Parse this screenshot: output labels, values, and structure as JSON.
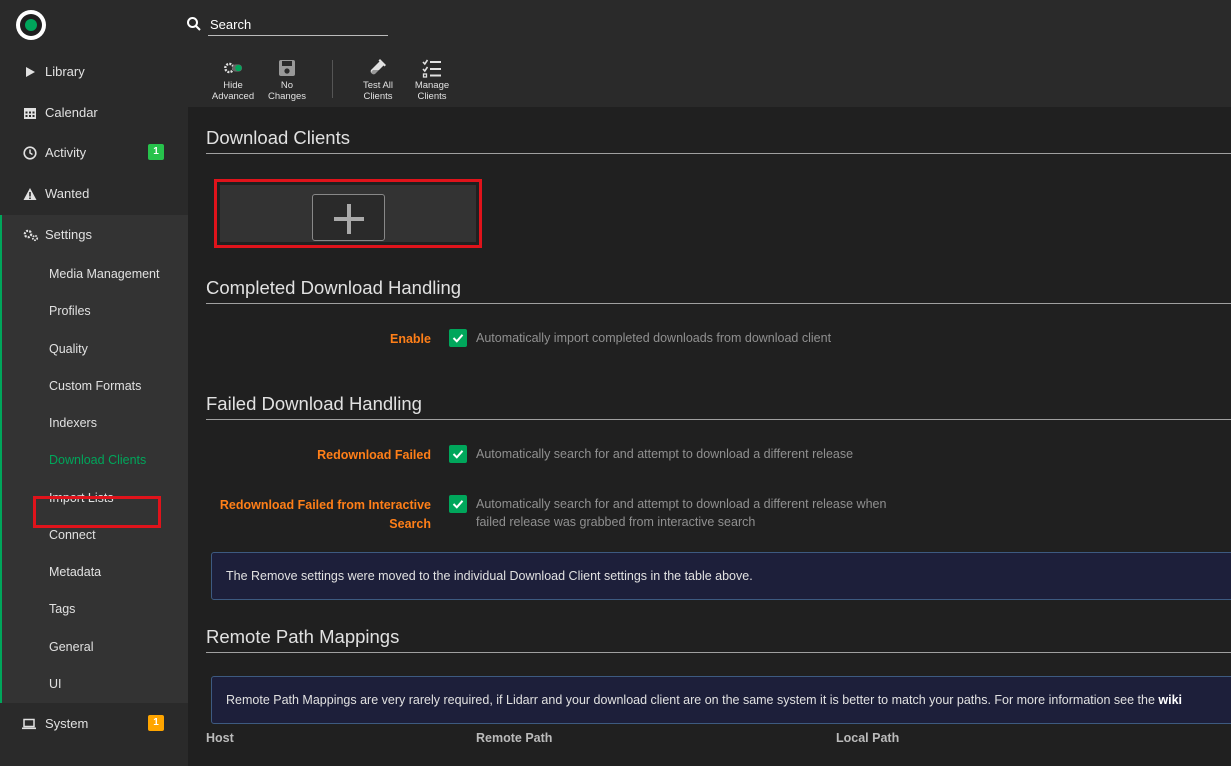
{
  "header": {
    "logo": "lidarr-logo-icon",
    "search_placeholder": "Search"
  },
  "sidebar": {
    "items": [
      {
        "label": "Library",
        "icon": "play-icon"
      },
      {
        "label": "Calendar",
        "icon": "calendar-icon"
      },
      {
        "label": "Activity",
        "icon": "clock-icon",
        "badge": "1",
        "badge_color": "#27c24c"
      },
      {
        "label": "Wanted",
        "icon": "warning-icon"
      },
      {
        "label": "Settings",
        "icon": "gears-icon"
      },
      {
        "label": "System",
        "icon": "laptop-icon",
        "badge": "1",
        "badge_color": "#ffa500"
      }
    ],
    "settings_subitems": [
      "Media Management",
      "Profiles",
      "Quality",
      "Custom Formats",
      "Indexers",
      "Download Clients",
      "Import Lists",
      "Connect",
      "Metadata",
      "Tags",
      "General",
      "UI"
    ],
    "active_subitem": "Download Clients"
  },
  "toolbar": {
    "hide_advanced": "Hide\nAdvanced",
    "no_changes": "No\nChanges",
    "test_all_clients": "Test All\nClients",
    "manage_clients": "Manage\nClients"
  },
  "sections": {
    "download_clients": "Download Clients",
    "completed_handling": "Completed Download Handling",
    "failed_handling": "Failed Download Handling",
    "remote_path": "Remote Path Mappings"
  },
  "fields": {
    "enable_label": "Enable",
    "enable_help": "Automatically import completed downloads from download client",
    "enable_checked": true,
    "redownload_label": "Redownload Failed",
    "redownload_help": "Automatically search for and attempt to download a different release",
    "redownload_checked": true,
    "redownload_interactive_label_1": "Redownload Failed from Interactive",
    "redownload_interactive_label_2": "Search",
    "redownload_interactive_help_1": "Automatically search for and attempt to download a different release when",
    "redownload_interactive_help_2": "failed release was grabbed from interactive search",
    "redownload_interactive_checked": true
  },
  "alerts": {
    "remove_settings": "The Remove settings were moved to the individual Download Client settings in the table above.",
    "remote_path_text": "Remote Path Mappings are very rarely required, if Lidarr and your download client are on the same system it is better to match your paths. For more information see the ",
    "remote_path_link": "wiki"
  },
  "table": {
    "columns": [
      "Host",
      "Remote Path",
      "Local Path"
    ]
  },
  "colors": {
    "accent": "#00a65b",
    "label_orange": "#ff7f18",
    "highlight_red": "#e0131b"
  }
}
